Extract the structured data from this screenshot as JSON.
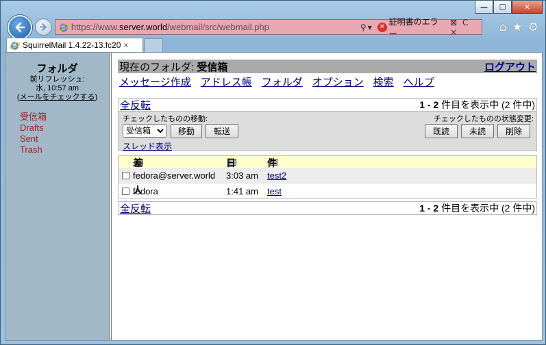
{
  "browser": {
    "url_prefix": "https://www.",
    "url_domain": "server.world",
    "url_path": "/webmail/src/webmail.php",
    "cert_error": "証明書のエラー",
    "tab_title": "SquirrelMail 1.4.22-13.fc20",
    "tab_close": "×"
  },
  "sidebar": {
    "title": "フォルダ",
    "refresh_label": "前リフレッシュ:",
    "refresh_time": "水, 10:57 am",
    "check_mail": "メールをチェックする",
    "folders": [
      "受信箱",
      "Drafts",
      "Sent",
      "Trash"
    ]
  },
  "header": {
    "current_folder_label": "現在のフォルダ:",
    "current_folder": "受信箱",
    "logout": "ログアウト"
  },
  "menu": [
    "メッセージ作成",
    "アドレス帳",
    "フォルダ",
    "オプション",
    "検索",
    "ヘルプ"
  ],
  "list_top": {
    "toggle_all": "全反転",
    "range": "1 - 2",
    "range_suffix": "件目を表示中 (2 件中)"
  },
  "ops": {
    "move_label": "チェックしたものの移動:",
    "status_label": "チェックしたものの状態変更:",
    "folder_select": "受信箱",
    "move_btn": "移動",
    "forward_btn": "転送",
    "read_btn": "既読",
    "unread_btn": "未読",
    "delete_btn": "削除",
    "thread_view": "スレッド表示"
  },
  "columns": {
    "from": "差出人",
    "date": "日付",
    "subject": "件名"
  },
  "messages": [
    {
      "from": "fedora@server.world",
      "date": "3:03 am",
      "subject": "test2"
    },
    {
      "from": "fedora",
      "date": "1:41 am",
      "subject": "test"
    }
  ]
}
